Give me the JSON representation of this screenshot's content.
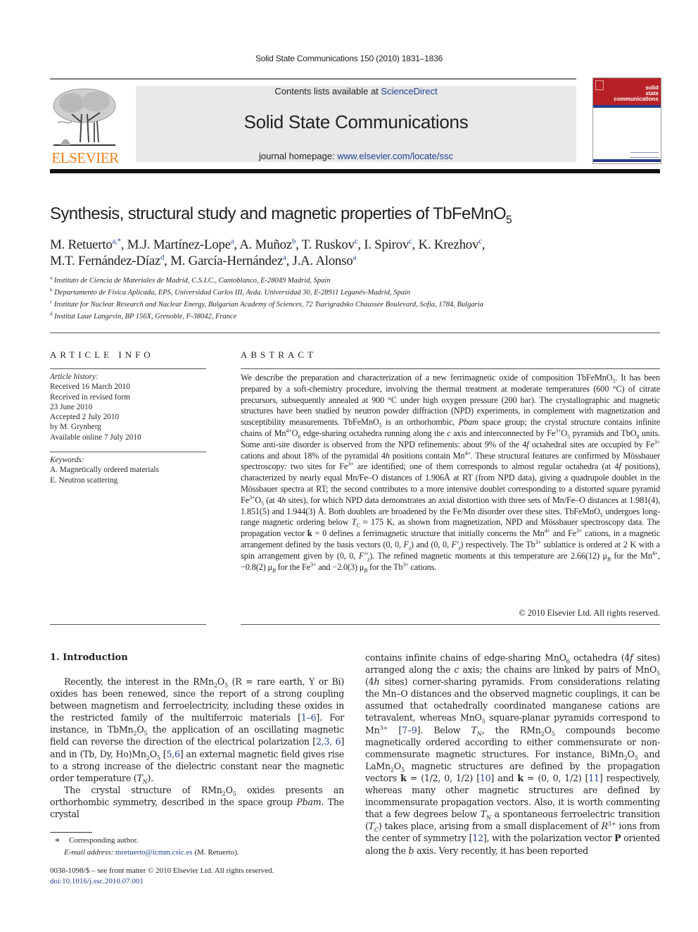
{
  "header": {
    "running_head": "Solid State Communications 150 (2010) 1831–1836",
    "contents_prefix": "Contents lists available at ",
    "contents_link": "ScienceDirect",
    "journal_title": "Solid State Communications",
    "homepage_prefix": "journal homepage: ",
    "homepage_link": "www.elsevier.com/locate/ssc",
    "publisher_logo_text": "ELSEVIER",
    "cover_text": [
      "solid",
      "state",
      "communications"
    ],
    "colors": {
      "publisher_orange": "#f07f1b",
      "link_blue": "#1d3f8f",
      "cover_red": "#b72126",
      "cover_blue": "#2a3b8a",
      "masthead_gray": "#e9e9e9"
    }
  },
  "article": {
    "title": "Synthesis, structural study and magnetic properties of TbFeMnO",
    "title_sub": "5",
    "authors": [
      {
        "name": "M. Retuerto",
        "sup": "a,*"
      },
      {
        "name": "M.J. Martínez-Lope",
        "sup": "a"
      },
      {
        "name": "A. Muñoz",
        "sup": "b"
      },
      {
        "name": "T. Ruskov",
        "sup": "c"
      },
      {
        "name": "I. Spirov",
        "sup": "c"
      },
      {
        "name": "K. Krezhov",
        "sup": "c"
      },
      {
        "name": "M.T. Fernández-Díaz",
        "sup": "d"
      },
      {
        "name": "M. García-Hernández",
        "sup": "a"
      },
      {
        "name": "J.A. Alonso",
        "sup": "a"
      }
    ],
    "affiliations": [
      {
        "key": "a",
        "text": "Instituto de Ciencia de Materiales de Madrid, C.S.I.C., Cantoblanco, E-28049 Madrid, Spain"
      },
      {
        "key": "b",
        "text": "Departamento de Física Aplicada, EPS, Universidad Carlos III, Avda. Universidad 30, E-28911 Leganés-Madrid, Spain"
      },
      {
        "key": "c",
        "text": "Institute for Nuclear Research and Nuclear Energy, Bulgarian Academy of Sciences, 72 Tsarigradsko Chaussee Boulevard, Sofia, 1784, Bulgaria"
      },
      {
        "key": "d",
        "text": "Institut Laue Langevin, BP 156X, Grenoble, F-38042, France"
      }
    ]
  },
  "article_info": {
    "heading": "ARTICLE INFO",
    "history_label": "Article history:",
    "history": [
      "Received 16 March 2010",
      "Received in revised form",
      "23 June 2010",
      "Accepted 2 July 2010",
      "by M. Grynberg",
      "Available online 7 July 2010"
    ],
    "keywords_label": "Keywords:",
    "keywords": [
      "A. Magnetically ordered materials",
      "E. Neutron scattering"
    ]
  },
  "abstract": {
    "heading": "ABSTRACT",
    "copyright": "© 2010 Elsevier Ltd. All rights reserved."
  },
  "body": {
    "section_heading": "1. Introduction"
  },
  "footnotes": {
    "star": "*",
    "corresponding": "Corresponding author.",
    "email_label": "E-mail address: ",
    "email": "mretuerto@icmm.csic.es",
    "email_name": " (M. Retuerto).",
    "front_matter": "0038-1098/$ – see front matter © 2010 Elsevier Ltd. All rights reserved.",
    "doi": "doi:10.1016/j.ssc.2010.07.001"
  }
}
